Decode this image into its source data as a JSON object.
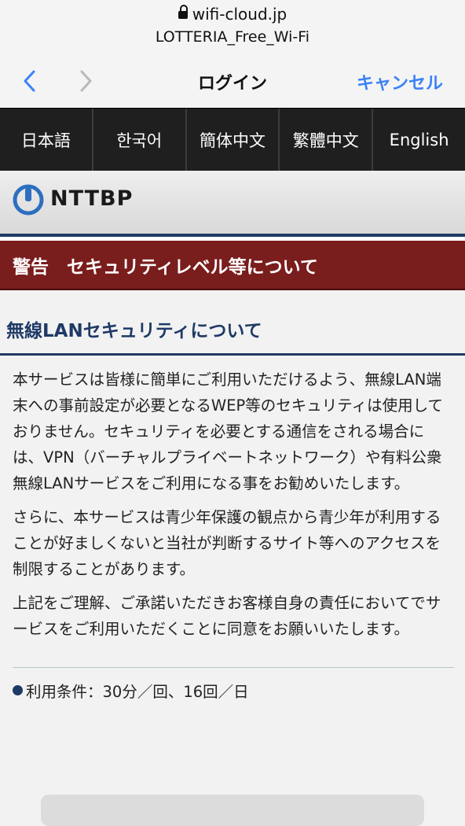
{
  "browser": {
    "url": "wifi-cloud.jp",
    "ssid": "LOTTERIA_Free_Wi-Fi",
    "title": "ログイン",
    "cancel_label": "キャンセル"
  },
  "languages": [
    {
      "label": "日本語"
    },
    {
      "label": "한국어"
    },
    {
      "label": "簡体中文"
    },
    {
      "label": "繁體中文"
    },
    {
      "label": "English"
    }
  ],
  "logo": {
    "text": "NTTBP"
  },
  "banner": {
    "text": "警告　セキュリティレベル等について"
  },
  "section": {
    "heading": "無線LANセキュリティについて",
    "paragraphs": [
      "本サービスは皆様に簡単にご利用いただけるよう、無線LAN端末への事前設定が必要となるWEP等のセキュリティは使用しておりません。セキュリティを必要とする通信をされる場合には、VPN（バーチャルプライベートネットワーク）や有料公衆無線LANサービスをご利用になる事をお勧めいたします。",
      "さらに、本サービスは青少年保護の観点から青少年が利用することが好ましくないと当社が判断するサイト等へのアクセスを制限することがあります。",
      "上記をご理解、ご承諾いただきお客様自身の責任においてでサービスをご利用いただくことに同意をお願いいたします。"
    ]
  },
  "terms": {
    "text": "利用条件：30分／回、16回／日"
  },
  "colors": {
    "accent_blue": "#3b82f6",
    "banner_red": "#7a1d1d",
    "heading_navy": "#1f3a66"
  }
}
